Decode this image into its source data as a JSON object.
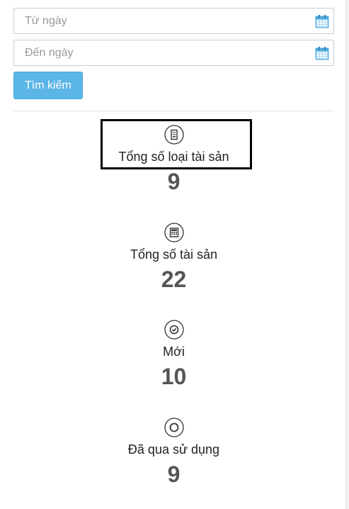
{
  "filters": {
    "from_date_placeholder": "Từ ngày",
    "to_date_placeholder": "Đến ngày",
    "from_date_value": "",
    "to_date_value": "",
    "search_label": "Tìm kiếm"
  },
  "stats": [
    {
      "icon": "building-icon",
      "label": "Tổng số loại tài sản",
      "value": "9"
    },
    {
      "icon": "calculator-icon",
      "label": "Tổng số tài sản",
      "value": "22"
    },
    {
      "icon": "check-circle-icon",
      "label": "Mới",
      "value": "10"
    },
    {
      "icon": "circle-icon",
      "label": "Đã qua sử dụng",
      "value": "9"
    }
  ],
  "colors": {
    "accent": "#5bb5e6",
    "value_text": "#555555",
    "highlight_border": "#000000"
  }
}
